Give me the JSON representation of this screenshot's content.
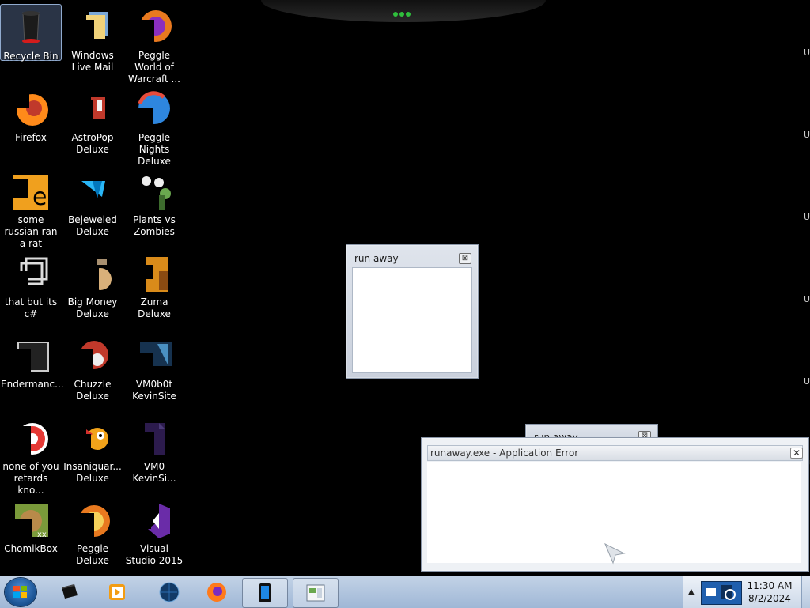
{
  "desktop": {
    "icons": [
      {
        "label": "Recycle Bin",
        "icon": "recycle-bin-icon"
      },
      {
        "label": "Windows Live Mail",
        "icon": "windows-live-mail-icon"
      },
      {
        "label": "Peggle World of Warcraft ...",
        "icon": "peggle-wow-icon"
      },
      {
        "label": "Firefox",
        "icon": "firefox-icon"
      },
      {
        "label": "AstroPop Deluxe",
        "icon": "astropop-icon"
      },
      {
        "label": "Peggle Nights Deluxe",
        "icon": "peggle-nights-icon"
      },
      {
        "label": "some russian ran a rat",
        "icon": "rat-icon"
      },
      {
        "label": "Bejeweled Deluxe",
        "icon": "bejeweled-icon"
      },
      {
        "label": "Plants vs Zombies",
        "icon": "plants-vs-zombies-icon"
      },
      {
        "label": "that but its c#",
        "icon": "shortcut-icon"
      },
      {
        "label": "Big Money Deluxe",
        "icon": "big-money-icon"
      },
      {
        "label": "Zuma Deluxe",
        "icon": "zuma-icon"
      },
      {
        "label": "Endermanc...",
        "icon": "terminal-icon"
      },
      {
        "label": "Chuzzle Deluxe",
        "icon": "chuzzle-icon"
      },
      {
        "label": "VM0b0t KevinSite",
        "icon": "folder-icon"
      },
      {
        "label": "none of you retards kno...",
        "icon": "chrome-icon"
      },
      {
        "label": "Insaniquar... Deluxe",
        "icon": "insaniquarium-icon"
      },
      {
        "label": "VM0 KevinSi...",
        "icon": "file-icon"
      },
      {
        "label": "ChomikBox",
        "icon": "chomikbox-icon"
      },
      {
        "label": "Peggle Deluxe",
        "icon": "peggle-icon"
      },
      {
        "label": "Visual Studio 2015",
        "icon": "visual-studio-icon"
      }
    ]
  },
  "edge_marks": [
    "U",
    "U",
    "U",
    "U",
    "U",
    "U"
  ],
  "windows": {
    "runaway": {
      "title": "run away",
      "close_label": "⊠"
    },
    "runaway_behind": {
      "title": "run away",
      "close_label": "⊠"
    },
    "error": {
      "title": "runaway.exe - Application Error",
      "close_label": "✕"
    }
  },
  "taskbar": {
    "buttons": [
      {
        "icon": "media-center-icon"
      },
      {
        "icon": "media-player-icon"
      },
      {
        "icon": "globe-icon"
      },
      {
        "icon": "firefox-icon"
      },
      {
        "icon": "phone-app-icon"
      },
      {
        "icon": "window-app-icon"
      }
    ],
    "tray_arrow": "▲",
    "clock_time": "11:30 AM",
    "clock_date": "8/2/2024"
  },
  "colors": {
    "accent": "#1f5fae",
    "desktop": "#000000",
    "firefox": "#ff7a1a"
  }
}
